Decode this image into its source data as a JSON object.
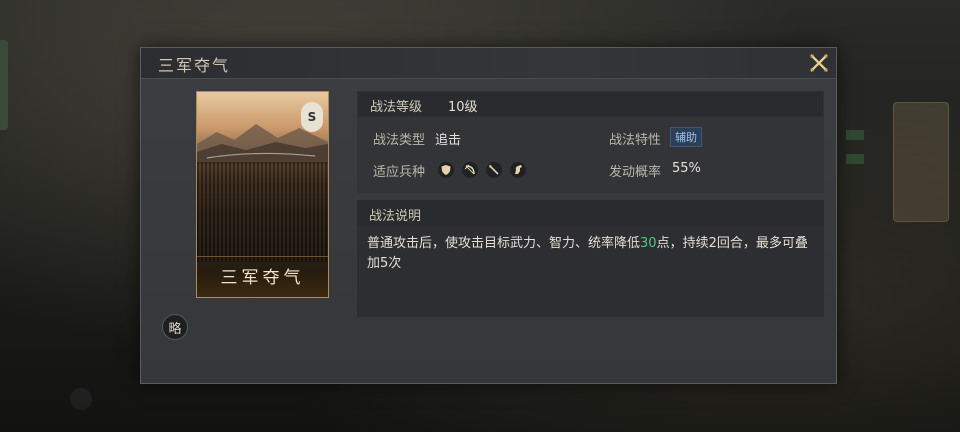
{
  "dialog": {
    "title": "三军夺气",
    "close_icon": "close-x-icon"
  },
  "card": {
    "name": "三军夺气",
    "emblem_text": "S",
    "emblem_icon": "faction-emblem-icon"
  },
  "strategy_badge": "略",
  "info": {
    "level_label": "战法等级",
    "level_value": "10级",
    "type_label": "战法类型",
    "type_value": "追击",
    "trait_label": "战法特性",
    "trait_value": "辅助",
    "units_label": "适应兵种",
    "units": [
      "shield-icon",
      "bow-icon",
      "spear-icon",
      "horse-icon"
    ],
    "chance_label": "发动概率",
    "chance_value": "55%"
  },
  "description": {
    "header": "战法说明",
    "text_before": "普通攻击后，使攻击目标武力、智力、统率降低",
    "highlight": "30",
    "text_after": "点，持续2回合，最多可叠加5次"
  },
  "colors": {
    "highlight": "#4fc77a",
    "gold_border": "#a88e55",
    "tag_blue": "#9fc0e8"
  }
}
